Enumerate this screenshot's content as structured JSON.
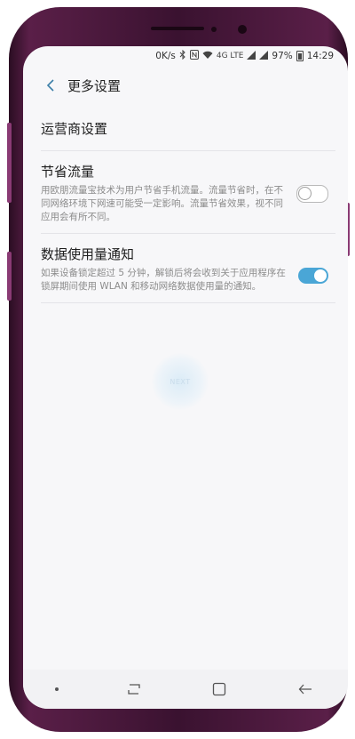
{
  "status_bar": {
    "network_speed": "0K/s",
    "network_labels": "4G LTE",
    "battery_percent": "97%",
    "time": "14:29"
  },
  "header": {
    "title": "更多设置"
  },
  "settings": [
    {
      "title": "运营商设置"
    },
    {
      "title": "节省流量",
      "description": "用欧朋流量宝技术为用户节省手机流量。流量节省时，在不同网络环境下网速可能受一定影响。流量节省效果，视不同应用会有所不同。",
      "toggle": "off"
    },
    {
      "title": "数据使用量通知",
      "description": "如果设备锁定超过 5 分钟，解锁后将会收到关于应用程序在锁屏期间使用 WLAN 和移动网络数据使用量的通知。",
      "toggle": "on"
    }
  ],
  "watermark": {
    "label": "NEXT"
  },
  "colors": {
    "accent": "#4aa6d6",
    "frame": "#5a1f48"
  },
  "icons": {
    "back": "chevron-left-icon",
    "recents": "recent-apps-icon",
    "home": "home-icon",
    "nav_back": "back-arrow-icon"
  }
}
